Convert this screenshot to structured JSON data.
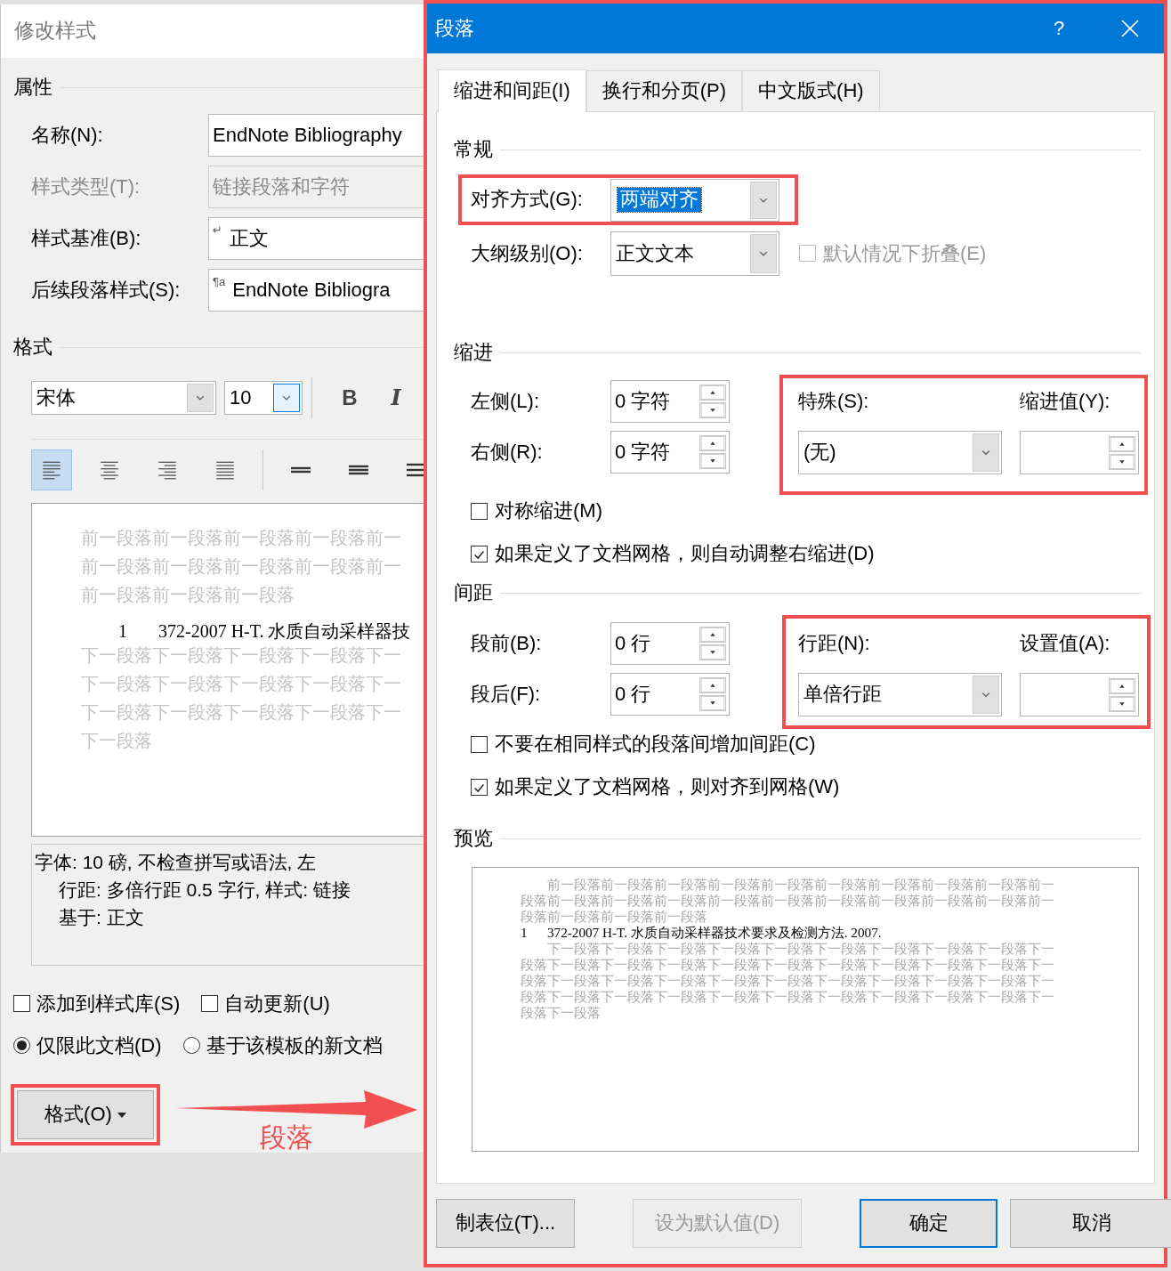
{
  "style_dialog": {
    "title": "修改样式",
    "properties_heading": "属性",
    "fields": [
      {
        "label": "名称(N):",
        "value": "EndNote Bibliography",
        "disabled": false
      },
      {
        "label": "样式类型(T):",
        "value": "链接段落和字符",
        "disabled": true
      },
      {
        "label": "样式基准(B):",
        "prefix": "↵",
        "value": "正文",
        "disabled": false
      },
      {
        "label": "后续段落样式(S):",
        "prefix": "¶a",
        "value": "EndNote Bibliogra",
        "disabled": false
      }
    ],
    "format_heading": "格式",
    "font": {
      "value": "宋体",
      "focused": false
    },
    "font_size": {
      "value": "10",
      "focused": true
    },
    "bold": "B",
    "italic": "I",
    "alignments": [
      {
        "kind": "left",
        "selected": true
      },
      {
        "kind": "center",
        "selected": false
      },
      {
        "kind": "right",
        "selected": false
      },
      {
        "kind": "justify",
        "selected": false
      }
    ],
    "spacings": [
      {
        "kind": "single",
        "selected": false
      },
      {
        "kind": "one-half",
        "selected": false
      },
      {
        "kind": "double",
        "selected": false
      }
    ],
    "preview": {
      "before_lines": [
        "前一段落前一段落前一段落前一段落前一",
        "前一段落前一段落前一段落前一段落前一",
        "前一段落前一段落前一段落"
      ],
      "entry_number": "1",
      "entry_text": "372-2007 H-T. 水质自动采样器技",
      "after_lines": [
        "下一段落下一段落下一段落下一段落下一",
        "下一段落下一段落下一段落下一段落下一",
        "下一段落下一段落下一段落下一段落下一",
        "下一段落"
      ]
    },
    "description": [
      "字体: 10 磅, 不检查拼写或语法, 左",
      "行距: 多倍行距 0.5 字行, 样式: 链接",
      "基于: 正文"
    ],
    "options": [
      {
        "label": "添加到样式库(S)",
        "checked": false
      },
      {
        "label": "自动更新(U)",
        "checked": false
      }
    ],
    "scope": [
      {
        "label": "仅限此文档(D)",
        "selected": true
      },
      {
        "label": "基于该模板的新文档",
        "selected": false
      }
    ],
    "format_button": {
      "label": "格式(O)",
      "highlighted": true
    },
    "annotation_label": "段落"
  },
  "paragraph_dialog": {
    "title": "段落",
    "help": "?",
    "highlighted": true,
    "tabs": [
      {
        "label": "缩进和间距(I)",
        "selected": true
      },
      {
        "label": "换行和分页(P)",
        "selected": false
      },
      {
        "label": "中文版式(H)",
        "selected": false
      }
    ],
    "general": {
      "heading": "常规",
      "alignment": {
        "label": "对齐方式(G):",
        "value": "两端对齐",
        "focused": true,
        "highlighted": true
      },
      "outline": {
        "label": "大纲级别(O):",
        "value": "正文文本"
      },
      "collapse": {
        "label": "默认情况下折叠(E)",
        "checked": false,
        "disabled": true
      }
    },
    "indent": {
      "heading": "缩进",
      "left": {
        "label": "左侧(L):",
        "value": "0 字符"
      },
      "right": {
        "label": "右侧(R):",
        "value": "0 字符"
      },
      "special": {
        "label": "特殊(S):",
        "value": "(无)"
      },
      "by": {
        "label": "缩进值(Y):"
      },
      "highlighted": true,
      "options": [
        {
          "label": "对称缩进(M)",
          "checked": false
        },
        {
          "label": "如果定义了文档网格，则自动调整右缩进(D)",
          "checked": true
        }
      ]
    },
    "spacing": {
      "heading": "间距",
      "before": {
        "label": "段前(B):",
        "value": "0 行"
      },
      "after": {
        "label": "段后(F):",
        "value": "0 行"
      },
      "line": {
        "label": "行距(N):",
        "value": "单倍行距"
      },
      "at": {
        "label": "设置值(A):"
      },
      "highlighted": true,
      "options": [
        {
          "label": "不要在相同样式的段落间增加间距(C)",
          "checked": false
        },
        {
          "label": "如果定义了文档网格，则对齐到网格(W)",
          "checked": true
        }
      ]
    },
    "preview": {
      "heading": "预览",
      "before_text": "前一段落前一段落前一段落前一段落前一段落前一段落前一段落前一段落前一段落前一段落前一段落前一段落前一段落前一段落前一段落前一段落前一段落前一段落前一段落前一段落前一段落前一段落前一段落",
      "entry_number": "1",
      "entry_text": "372-2007 H-T. 水质自动采样器技术要求及检测方法. 2007.",
      "after_text": "下一段落下一段落下一段落下一段落下一段落下一段落下一段落下一段落下一段落下一段落下一段落下一段落下一段落下一段落下一段落下一段落下一段落下一段落下一段落下一段落下一段落下一段落下一段落下一段落下一段落下一段落下一段落下一段落下一段落下一段落下一段落下一段落下一段落下一段落下一段落下一段落下一段落下一段落下一段落下一段落下一段落"
    },
    "buttons": [
      {
        "label": "制表位(T)...",
        "disabled": false,
        "default": false
      },
      {
        "label": "设为默认值(D)",
        "disabled": true,
        "default": false
      },
      {
        "label": "确定",
        "disabled": false,
        "default": true
      },
      {
        "label": "取消",
        "disabled": false,
        "default": false
      }
    ]
  }
}
